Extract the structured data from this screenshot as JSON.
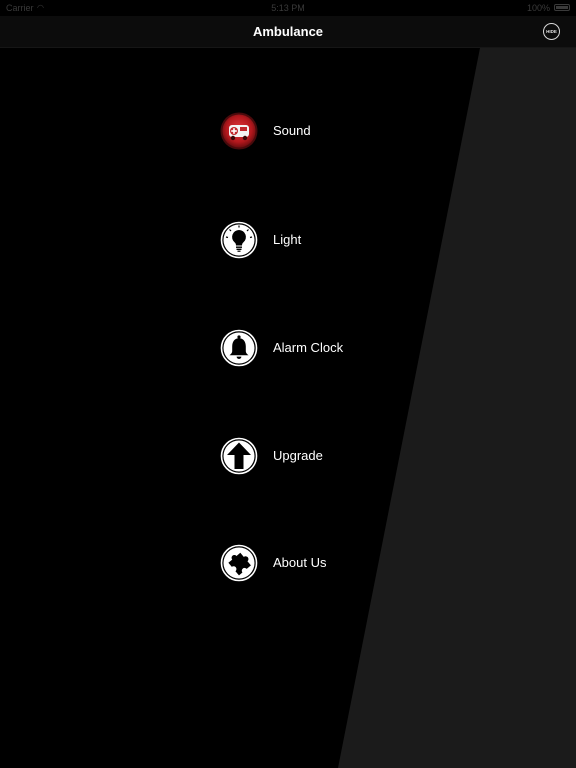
{
  "status_bar": {
    "carrier": "Carrier",
    "wifi_icon": "wifi-icon",
    "time": "5:13 PM",
    "battery": "100%"
  },
  "nav": {
    "title": "Ambulance",
    "hide_label": "HIDE"
  },
  "menu": {
    "items": [
      {
        "label": "Sound",
        "icon": "ambulance-siren-icon",
        "active": true
      },
      {
        "label": "Light",
        "icon": "lightbulb-icon"
      },
      {
        "label": "Alarm Clock",
        "icon": "bell-icon"
      },
      {
        "label": "Upgrade",
        "icon": "arrow-up-icon"
      },
      {
        "label": "About Us",
        "icon": "puzzle-piece-icon"
      }
    ]
  },
  "colors": {
    "background": "#000000",
    "diagonal_panel": "#1b1b1b",
    "active_icon": "#c0282d",
    "text": "#ffffff"
  }
}
